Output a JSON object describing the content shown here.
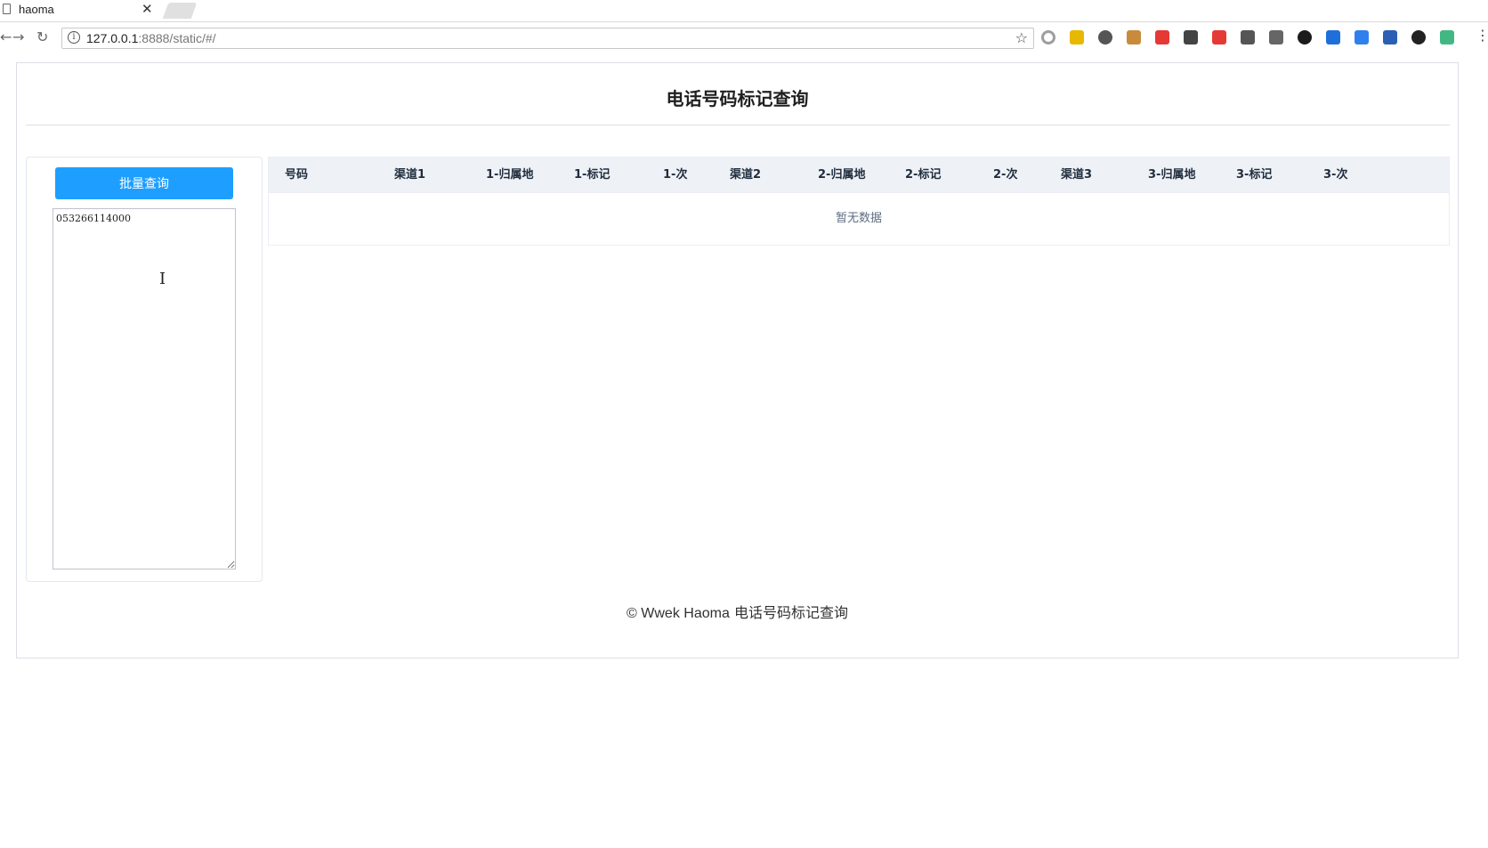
{
  "browser": {
    "tab_title": "haoma",
    "url_host": "127.0.0.1",
    "url_path": ":8888/static/#/"
  },
  "extensions": [
    {
      "icon": "circle-ext-icon",
      "color": "#9e9e9e"
    },
    {
      "icon": "note-ext-icon",
      "color": "#e6b800"
    },
    {
      "icon": "gear-ext-icon",
      "color": "#555555"
    },
    {
      "icon": "cookie-ext-icon",
      "color": "#c98a3b"
    },
    {
      "icon": "fe-ext-icon",
      "color": "#e53935"
    },
    {
      "icon": "link-ext-icon",
      "color": "#444444"
    },
    {
      "icon": "red-ext-icon",
      "color": "#e53935"
    },
    {
      "icon": "feather-ext-icon",
      "color": "#555555"
    },
    {
      "icon": "download-ext-icon",
      "color": "#666666"
    },
    {
      "icon": "color-ring-ext-icon",
      "color": "#1b1b1b"
    },
    {
      "icon": "xmind-ext-icon",
      "color": "#1e6fd9"
    },
    {
      "icon": "pen-ext-icon",
      "color": "#2f80ed"
    },
    {
      "icon": "lambda-ext-icon",
      "color": "#2b5fb3"
    },
    {
      "icon": "power-ext-icon",
      "color": "#222222"
    },
    {
      "icon": "vue-ext-icon",
      "color": "#41b883"
    }
  ],
  "page": {
    "title": "电话号码标记查询",
    "batch_button": "批量查询",
    "numbers_input": "053266114000",
    "columns": [
      "号码",
      "渠道1",
      "1-归属地",
      "1-标记",
      "1-次",
      "渠道2",
      "2-归属地",
      "2-标记",
      "2-次",
      "渠道3",
      "3-归属地",
      "3-标记",
      "3-次"
    ],
    "empty_text": "暂无数据",
    "footer_copy": "© Wwek Haoma",
    "footer_text": "电话号码标记查询"
  },
  "colors": {
    "primary": "#1e9fff",
    "table_header_bg": "#eef1f6",
    "border": "#dcdfe6"
  }
}
